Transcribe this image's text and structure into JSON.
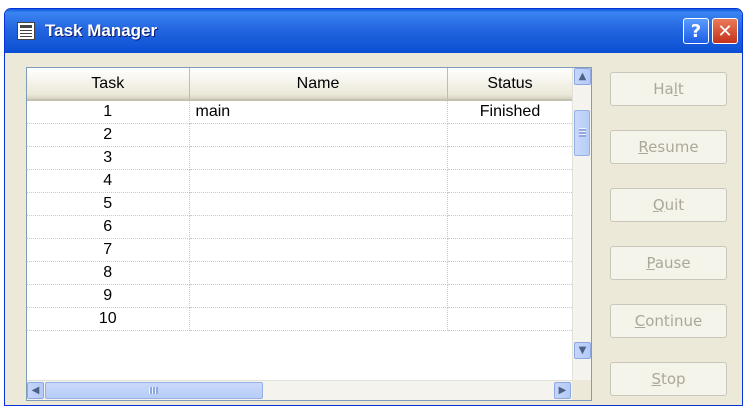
{
  "window": {
    "title": "Task Manager",
    "help_glyph": "?",
    "close_glyph": "✕"
  },
  "grid": {
    "columns": [
      "Task",
      "Name",
      "Status"
    ],
    "rows": [
      {
        "task": "1",
        "name": "main",
        "status": "Finished"
      },
      {
        "task": "2",
        "name": "",
        "status": ""
      },
      {
        "task": "3",
        "name": "",
        "status": ""
      },
      {
        "task": "4",
        "name": "",
        "status": ""
      },
      {
        "task": "5",
        "name": "",
        "status": ""
      },
      {
        "task": "6",
        "name": "",
        "status": ""
      },
      {
        "task": "7",
        "name": "",
        "status": ""
      },
      {
        "task": "8",
        "name": "",
        "status": ""
      },
      {
        "task": "9",
        "name": "",
        "status": ""
      },
      {
        "task": "10",
        "name": "",
        "status": ""
      }
    ],
    "scroll_arrows": {
      "up": "▲",
      "down": "▼",
      "left": "◀",
      "right": "▶"
    }
  },
  "buttons": [
    {
      "pre": "Ha",
      "accel": "l",
      "post": "t",
      "enabled": false
    },
    {
      "pre": "",
      "accel": "R",
      "post": "esume",
      "enabled": false
    },
    {
      "pre": "",
      "accel": "Q",
      "post": "uit",
      "enabled": false
    },
    {
      "pre": "",
      "accel": "P",
      "post": "ause",
      "enabled": false
    },
    {
      "pre": "",
      "accel": "C",
      "post": "ontinue",
      "enabled": false
    },
    {
      "pre": "",
      "accel": "S",
      "post": "top",
      "enabled": false
    }
  ],
  "colors": {
    "titlebar": "#2466e0",
    "window_bg": "#ece9d8",
    "disabled_text": "#aca899"
  }
}
